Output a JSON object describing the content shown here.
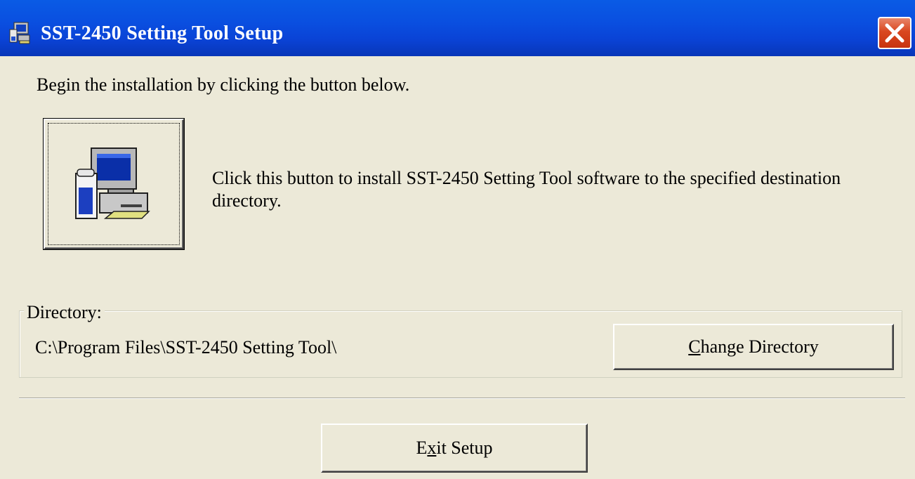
{
  "window": {
    "title": "SST-2450 Setting Tool Setup",
    "title_icon": "setup-computer-icon",
    "close_icon": "close-icon",
    "titlebar_color": "#0A4FE0",
    "close_color": "#D9471F",
    "background_color": "#ECE9D8"
  },
  "intro_text": "Begin the installation by clicking the button below.",
  "install": {
    "icon": "setup-computer-icon",
    "description": "Click this button to install SST-2450 Setting Tool software to the specified destination directory."
  },
  "directory": {
    "group_label": "Directory:",
    "path": "C:\\Program Files\\SST-2450 Setting Tool\\",
    "change_button": {
      "mnemonic": "C",
      "rest": "hange Directory"
    }
  },
  "exit_button": {
    "before": "E",
    "mnemonic": "x",
    "after": "it Setup"
  }
}
